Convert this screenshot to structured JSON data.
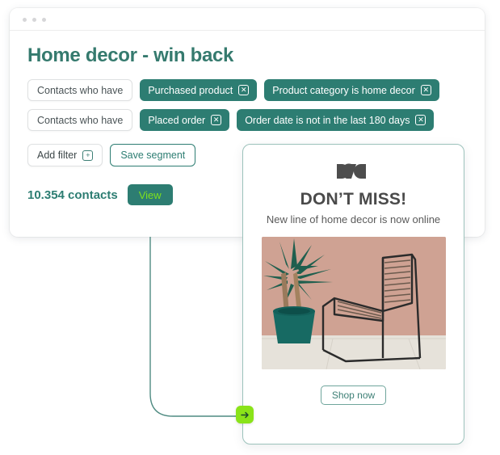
{
  "window": {
    "dots": [
      "window-dot-1",
      "window-dot-2",
      "window-dot-3"
    ]
  },
  "segment_builder": {
    "title": "Home decor - win back",
    "filter_rows": [
      {
        "prefix_label": "Contacts who have",
        "chips": [
          {
            "label": "Purchased product",
            "remove_icon": "✕"
          },
          {
            "label": "Product category is home decor",
            "remove_icon": "✕"
          }
        ]
      },
      {
        "prefix_label": "Contacts who have",
        "chips": [
          {
            "label": "Placed order",
            "remove_icon": "✕"
          },
          {
            "label": "Order date is not in the last 180 days",
            "remove_icon": "✕"
          }
        ]
      }
    ],
    "add_filter_label": "Add filter",
    "add_filter_icon": "+",
    "save_segment_label": "Save segment",
    "contacts_count": "10.354 contacts",
    "view_label": "View"
  },
  "email_preview": {
    "logo_name": "brand-logo",
    "heading": "DON’T MISS!",
    "subheading": "New line of home decor is now online",
    "photo_alt": "Yucca plant in teal pot beside a black wire chair against a pink wall",
    "shop_now_label": "Shop now"
  },
  "connector": {
    "arrow_icon": "→"
  },
  "colors": {
    "teal": "#2d7d72",
    "teal_heading": "#357a6e",
    "lime": "#8ae319",
    "view_text": "#7ee01f",
    "card_border": "#9cc2bb",
    "dark_text": "#4a4a4a"
  }
}
